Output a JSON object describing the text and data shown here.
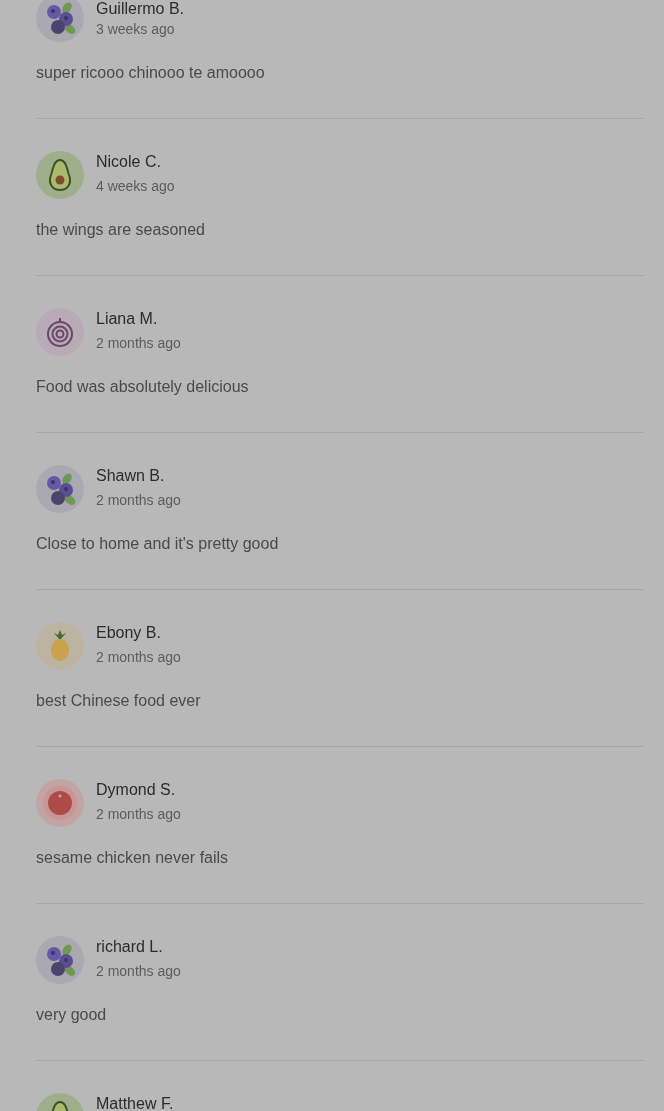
{
  "reviews": [
    {
      "author": "Guillermo B.",
      "time": "3 weeks ago",
      "text": "super ricooo chinooo te amoooo",
      "avatar": {
        "kind": "blueberry"
      }
    },
    {
      "author": "Nicole C.",
      "time": "4 weeks ago",
      "text": "the wings are seasoned",
      "avatar": {
        "kind": "avocado"
      }
    },
    {
      "author": "Liana M.",
      "time": "2 months ago",
      "text": "Food was absolutely delicious",
      "avatar": {
        "kind": "onion"
      }
    },
    {
      "author": "Shawn B.",
      "time": "2 months ago",
      "text": "Close to home and it's pretty good",
      "avatar": {
        "kind": "blueberry"
      }
    },
    {
      "author": "Ebony B.",
      "time": "2 months ago",
      "text": "best Chinese food ever",
      "avatar": {
        "kind": "pineapple"
      }
    },
    {
      "author": "Dymond S.",
      "time": "2 months ago",
      "text": "sesame chicken never fails",
      "avatar": {
        "kind": "tomato"
      }
    },
    {
      "author": "richard L.",
      "time": "2 months ago",
      "text": "very good",
      "avatar": {
        "kind": "blueberry"
      }
    },
    {
      "author": "Matthew F.",
      "avatar": {
        "kind": "avocado"
      }
    }
  ]
}
